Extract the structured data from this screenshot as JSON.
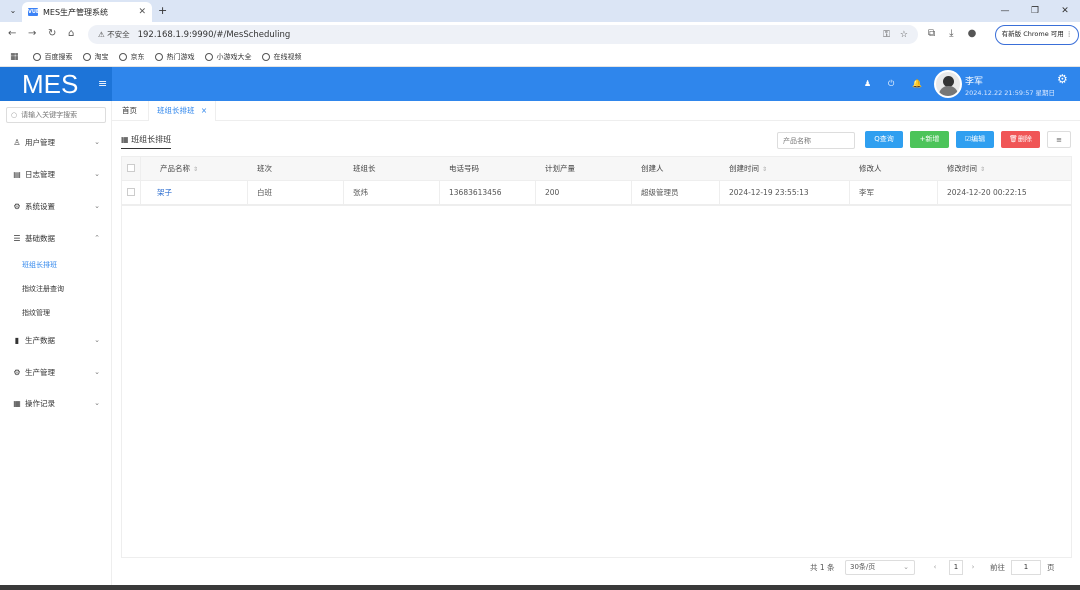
{
  "browser": {
    "tab_title": "MES生产管理系统",
    "tab_favicon": "VUE",
    "new_tab": "+",
    "insecure_label": "不安全",
    "url": "192.168.1.9:9990/#/MesScheduling",
    "chrome_pill": "有新版 Chrome 可用 ⋮",
    "bookmarks": [
      "百度搜索",
      "淘宝",
      "京东",
      "热门游戏",
      "小游戏大全",
      "在线视频"
    ]
  },
  "header": {
    "logo": "MES",
    "user_name": "李军",
    "user_time": "2024.12.22 21:59:57 星期日"
  },
  "sidebar": {
    "search_placeholder": "请输入关键字搜索",
    "menu": [
      {
        "label": "用户管理",
        "icon": "user-icon"
      },
      {
        "label": "日志管理",
        "icon": "calendar-icon"
      },
      {
        "label": "系统设置",
        "icon": "gear-icon"
      },
      {
        "label": "基础数据",
        "icon": "sliders-icon"
      },
      {
        "label": "生产数据",
        "icon": "chart-icon"
      },
      {
        "label": "生产管理",
        "icon": "gear-icon"
      },
      {
        "label": "操作记录",
        "icon": "grid-icon"
      }
    ],
    "submenu": [
      "班组长排班",
      "指纹注册查询",
      "指纹管理"
    ]
  },
  "content_tabs": {
    "home": "首页",
    "active": "班组长排班",
    "close": "×"
  },
  "panel": {
    "title": "班组长排班",
    "search_placeholder": "产品名称",
    "buttons": {
      "query": "Q查询",
      "add": "+新增",
      "edit": "☑编辑",
      "delete": "🗑删除",
      "columns": "≡"
    }
  },
  "table": {
    "headers": [
      "产品名称",
      "班次",
      "班组长",
      "电话号码",
      "计划产量",
      "创建人",
      "创建时间",
      "修改人",
      "修改时间"
    ],
    "rows": [
      [
        "架子",
        "白班",
        "张炜",
        "13683613456",
        "200",
        "超级管理员",
        "2024-12-19 23:55:13",
        "李军",
        "2024-12-20 00:22:15"
      ]
    ]
  },
  "pager": {
    "total": "共 1 条",
    "page_size": "30条/页",
    "current": "1",
    "goto_label": "前往",
    "goto_value": "1",
    "page_unit": "页",
    "prev": "‹",
    "next": "›"
  }
}
